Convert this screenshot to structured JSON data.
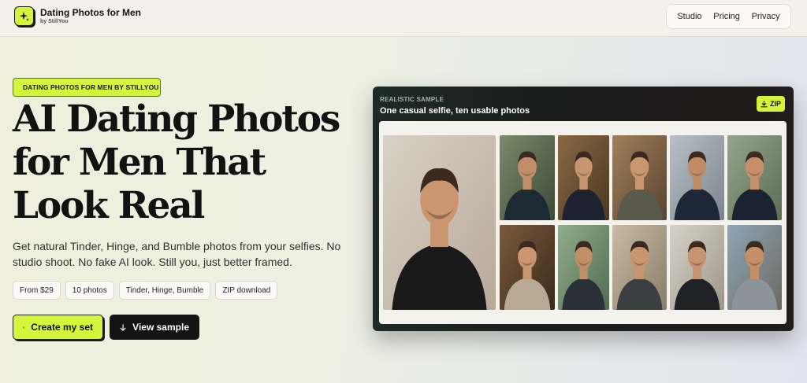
{
  "header": {
    "brand_title": "Dating Photos for Men",
    "brand_sub": "by StillYou",
    "logo_icon": "sparkle-icon",
    "nav": [
      "Studio",
      "Pricing",
      "Privacy"
    ]
  },
  "hero": {
    "eyebrow": "DATING PHOTOS FOR MEN BY STILLYOU",
    "headline": [
      "AI Dating Photos",
      "for Men That",
      "Look Real"
    ],
    "subtitle": "Get natural Tinder, Hinge, and Bumble photos from your selfies. No studio shoot. No fake AI look. Still you, just better framed.",
    "chips": [
      "From $29",
      "10 photos",
      "Tinder, Hinge, Bumble",
      "ZIP download"
    ],
    "cta_primary": "Create my set",
    "cta_secondary": "View sample"
  },
  "sample": {
    "label": "REALISTIC SAMPLE",
    "title": "One casual selfie, ten usable photos",
    "zip_label": "ZIP",
    "photos": [
      "casual-selfie",
      "portrait-dark-shirt",
      "cafe-coffee",
      "bookshelf-portrait",
      "street-navy-jacket",
      "park-tshirt",
      "dinner-table",
      "outdoor-drink",
      "cafe-sweater",
      "blazer-portrait",
      "coastal-evening"
    ]
  },
  "colors": {
    "accent": "#d4f53c",
    "dark": "#141414",
    "card_bg": "#1b1c1c"
  }
}
